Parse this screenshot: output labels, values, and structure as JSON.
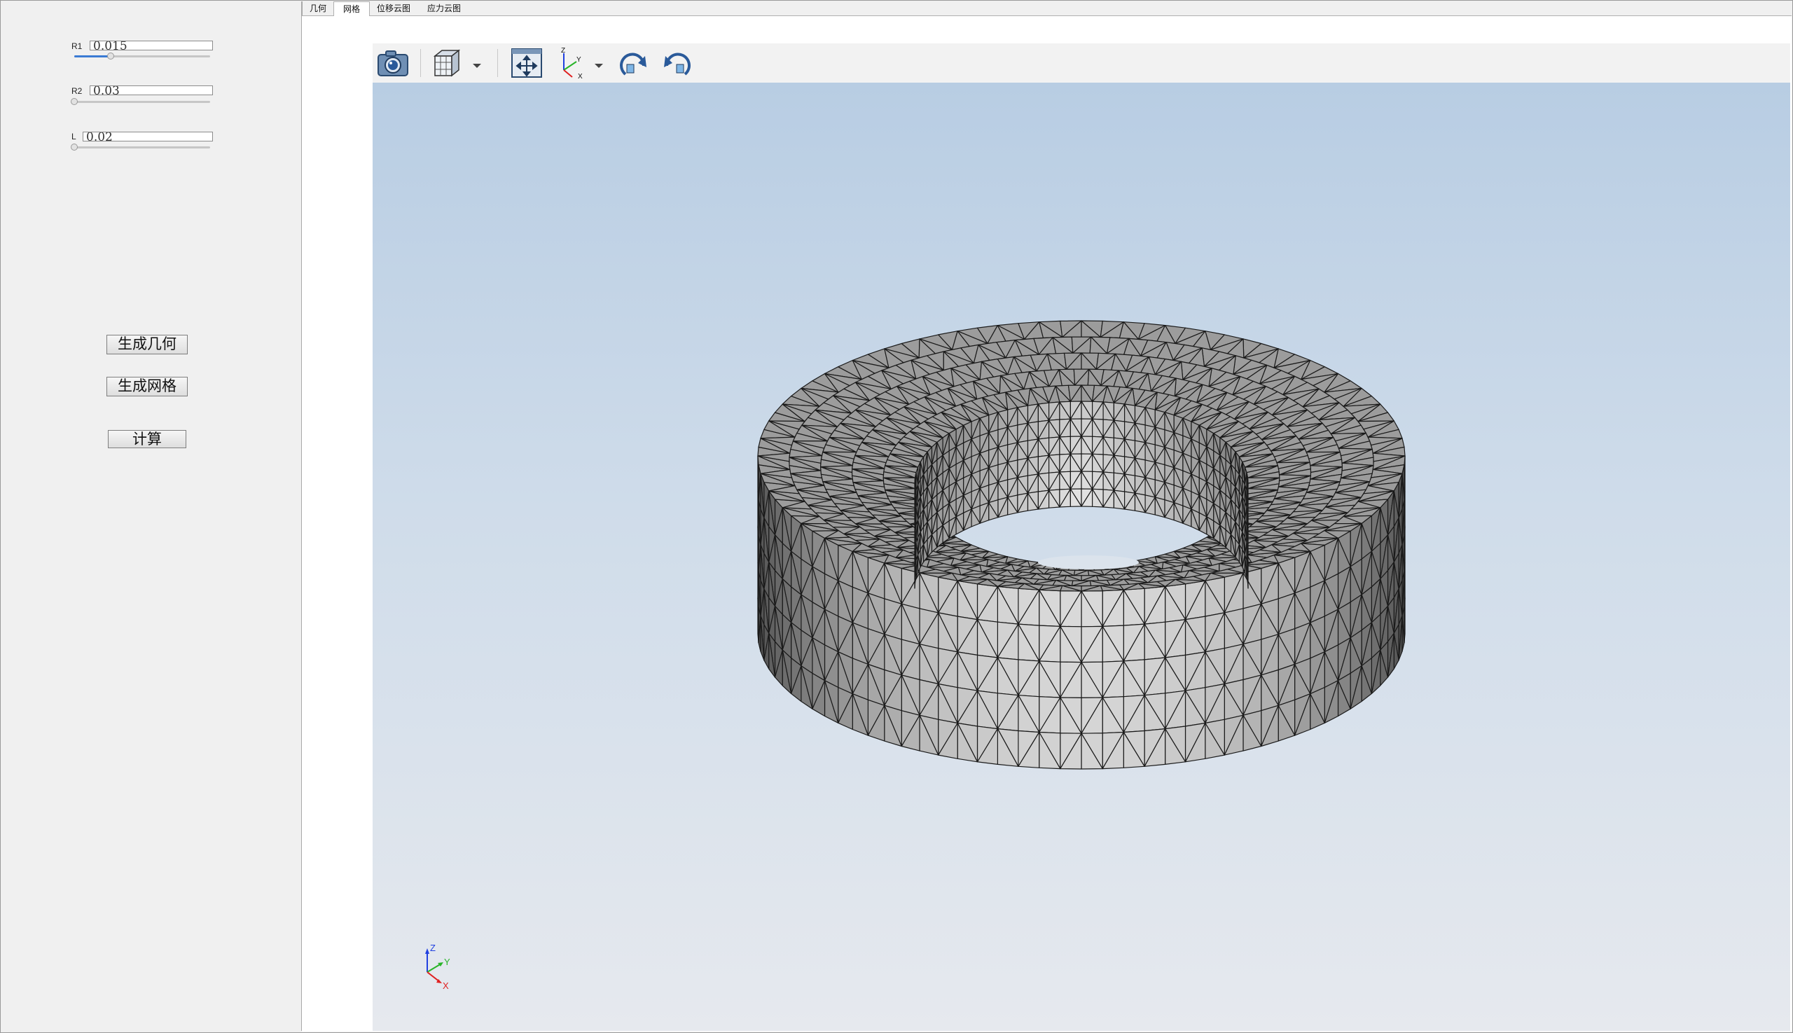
{
  "tabs": [
    {
      "label": "几何"
    },
    {
      "label": "网格"
    },
    {
      "label": "位移云图"
    },
    {
      "label": "应力云图"
    }
  ],
  "active_tab": "网格",
  "params": {
    "r1": {
      "label": "R1",
      "value": "0.015",
      "slider_fraction": 0.27
    },
    "r2": {
      "label": "R2",
      "value": "0.03",
      "slider_fraction": 0.0
    },
    "l": {
      "label": "L",
      "value": "0.02",
      "slider_fraction": 0.0
    }
  },
  "buttons": {
    "generate_geometry": "生成几何",
    "generate_mesh": "生成网格",
    "compute": "计算"
  },
  "toolbar": {
    "icons": [
      "camera-icon",
      "view-cube-icon",
      "fit-all-icon",
      "axes-view-icon",
      "rotate-cw-icon",
      "rotate-ccw-icon"
    ]
  },
  "triad": {
    "x": "X",
    "y": "Y",
    "z": "Z"
  },
  "colors": {
    "x_axis": "#e02020",
    "y_axis": "#28b428",
    "z_axis": "#2040e0",
    "mesh_light": "#d4d4d4",
    "mesh_mid": "#9c9c9c",
    "mesh_dark": "#5a5a5a"
  }
}
